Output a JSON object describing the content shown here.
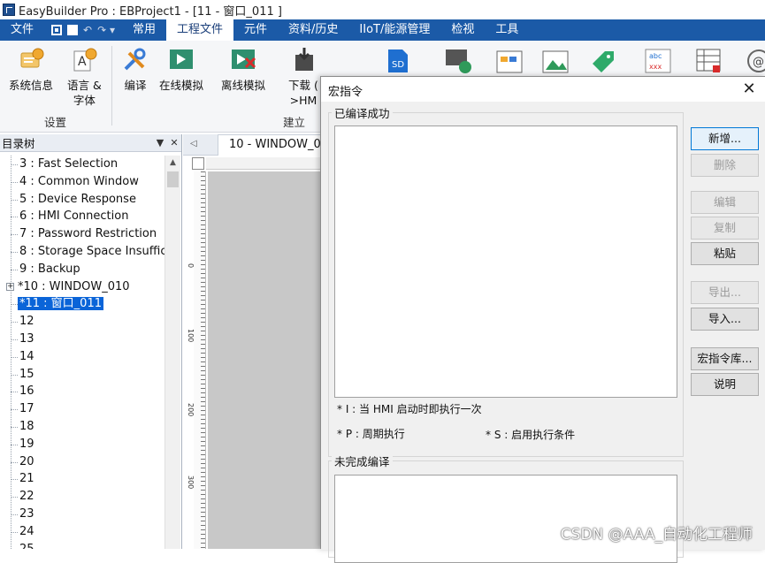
{
  "window": {
    "title": "EasyBuilder Pro : EBProject1 - [11 - 窗口_011 ]"
  },
  "menubar": {
    "items": [
      "文件",
      "常用",
      "工程文件",
      "元件",
      "资料/历史",
      "IIoT/能源管理",
      "检视",
      "工具"
    ],
    "active": "工程文件"
  },
  "ribbon": {
    "buttons": {
      "system_info": "系统信息",
      "language_font": "语言 &\n字体",
      "compile": "编译",
      "online_sim": "在线模拟",
      "offline_sim": "离线模拟",
      "download": "下载 (\n>HM"
    },
    "groups": {
      "settings": "设置",
      "build": "建立"
    },
    "icons": [
      "sd-card-icon",
      "network-refresh-icon",
      "image-gallery-icon",
      "picture-icon",
      "tag-icon",
      "text-replace-icon",
      "table-icon",
      "at-sign-icon"
    ]
  },
  "tree": {
    "header": "目录树",
    "items": [
      "3 : Fast Selection",
      "4 : Common Window",
      "5 : Device Response",
      "6 : HMI Connection",
      "7 : Password Restriction",
      "8 : Storage Space Insuffic",
      "9 : Backup",
      "*10 : WINDOW_010",
      "*11 : 窗口_011",
      "12",
      "13",
      "14",
      "15",
      "16",
      "17",
      "18",
      "19",
      "20",
      "21",
      "22",
      "23",
      "24",
      "25"
    ],
    "selected_index": 8,
    "expander_index": 7
  },
  "editor": {
    "tab_label": "10 - WINDOW_010",
    "ruler_numbers": [
      "0",
      "100",
      "200",
      "300"
    ]
  },
  "dialog": {
    "title": "宏指令",
    "compiled_label": "已编译成功",
    "incomplete_label": "未完成编译",
    "note_i": "* I : 当 HMI 启动时即执行一次",
    "note_p": "* P : 周期执行",
    "note_s": "* S : 启用执行条件",
    "buttons": {
      "new": "新增...",
      "delete": "删除",
      "edit": "编辑",
      "copy": "复制",
      "paste": "粘贴",
      "export": "导出...",
      "import": "导入...",
      "library": "宏指令库...",
      "help": "说明"
    }
  },
  "watermark": "CSDN @AAA_自动化工程师",
  "colors": {
    "menubar": "#1b5aa7",
    "selection": "#0a64d8",
    "dialog_bg": "#f0f0f0"
  }
}
